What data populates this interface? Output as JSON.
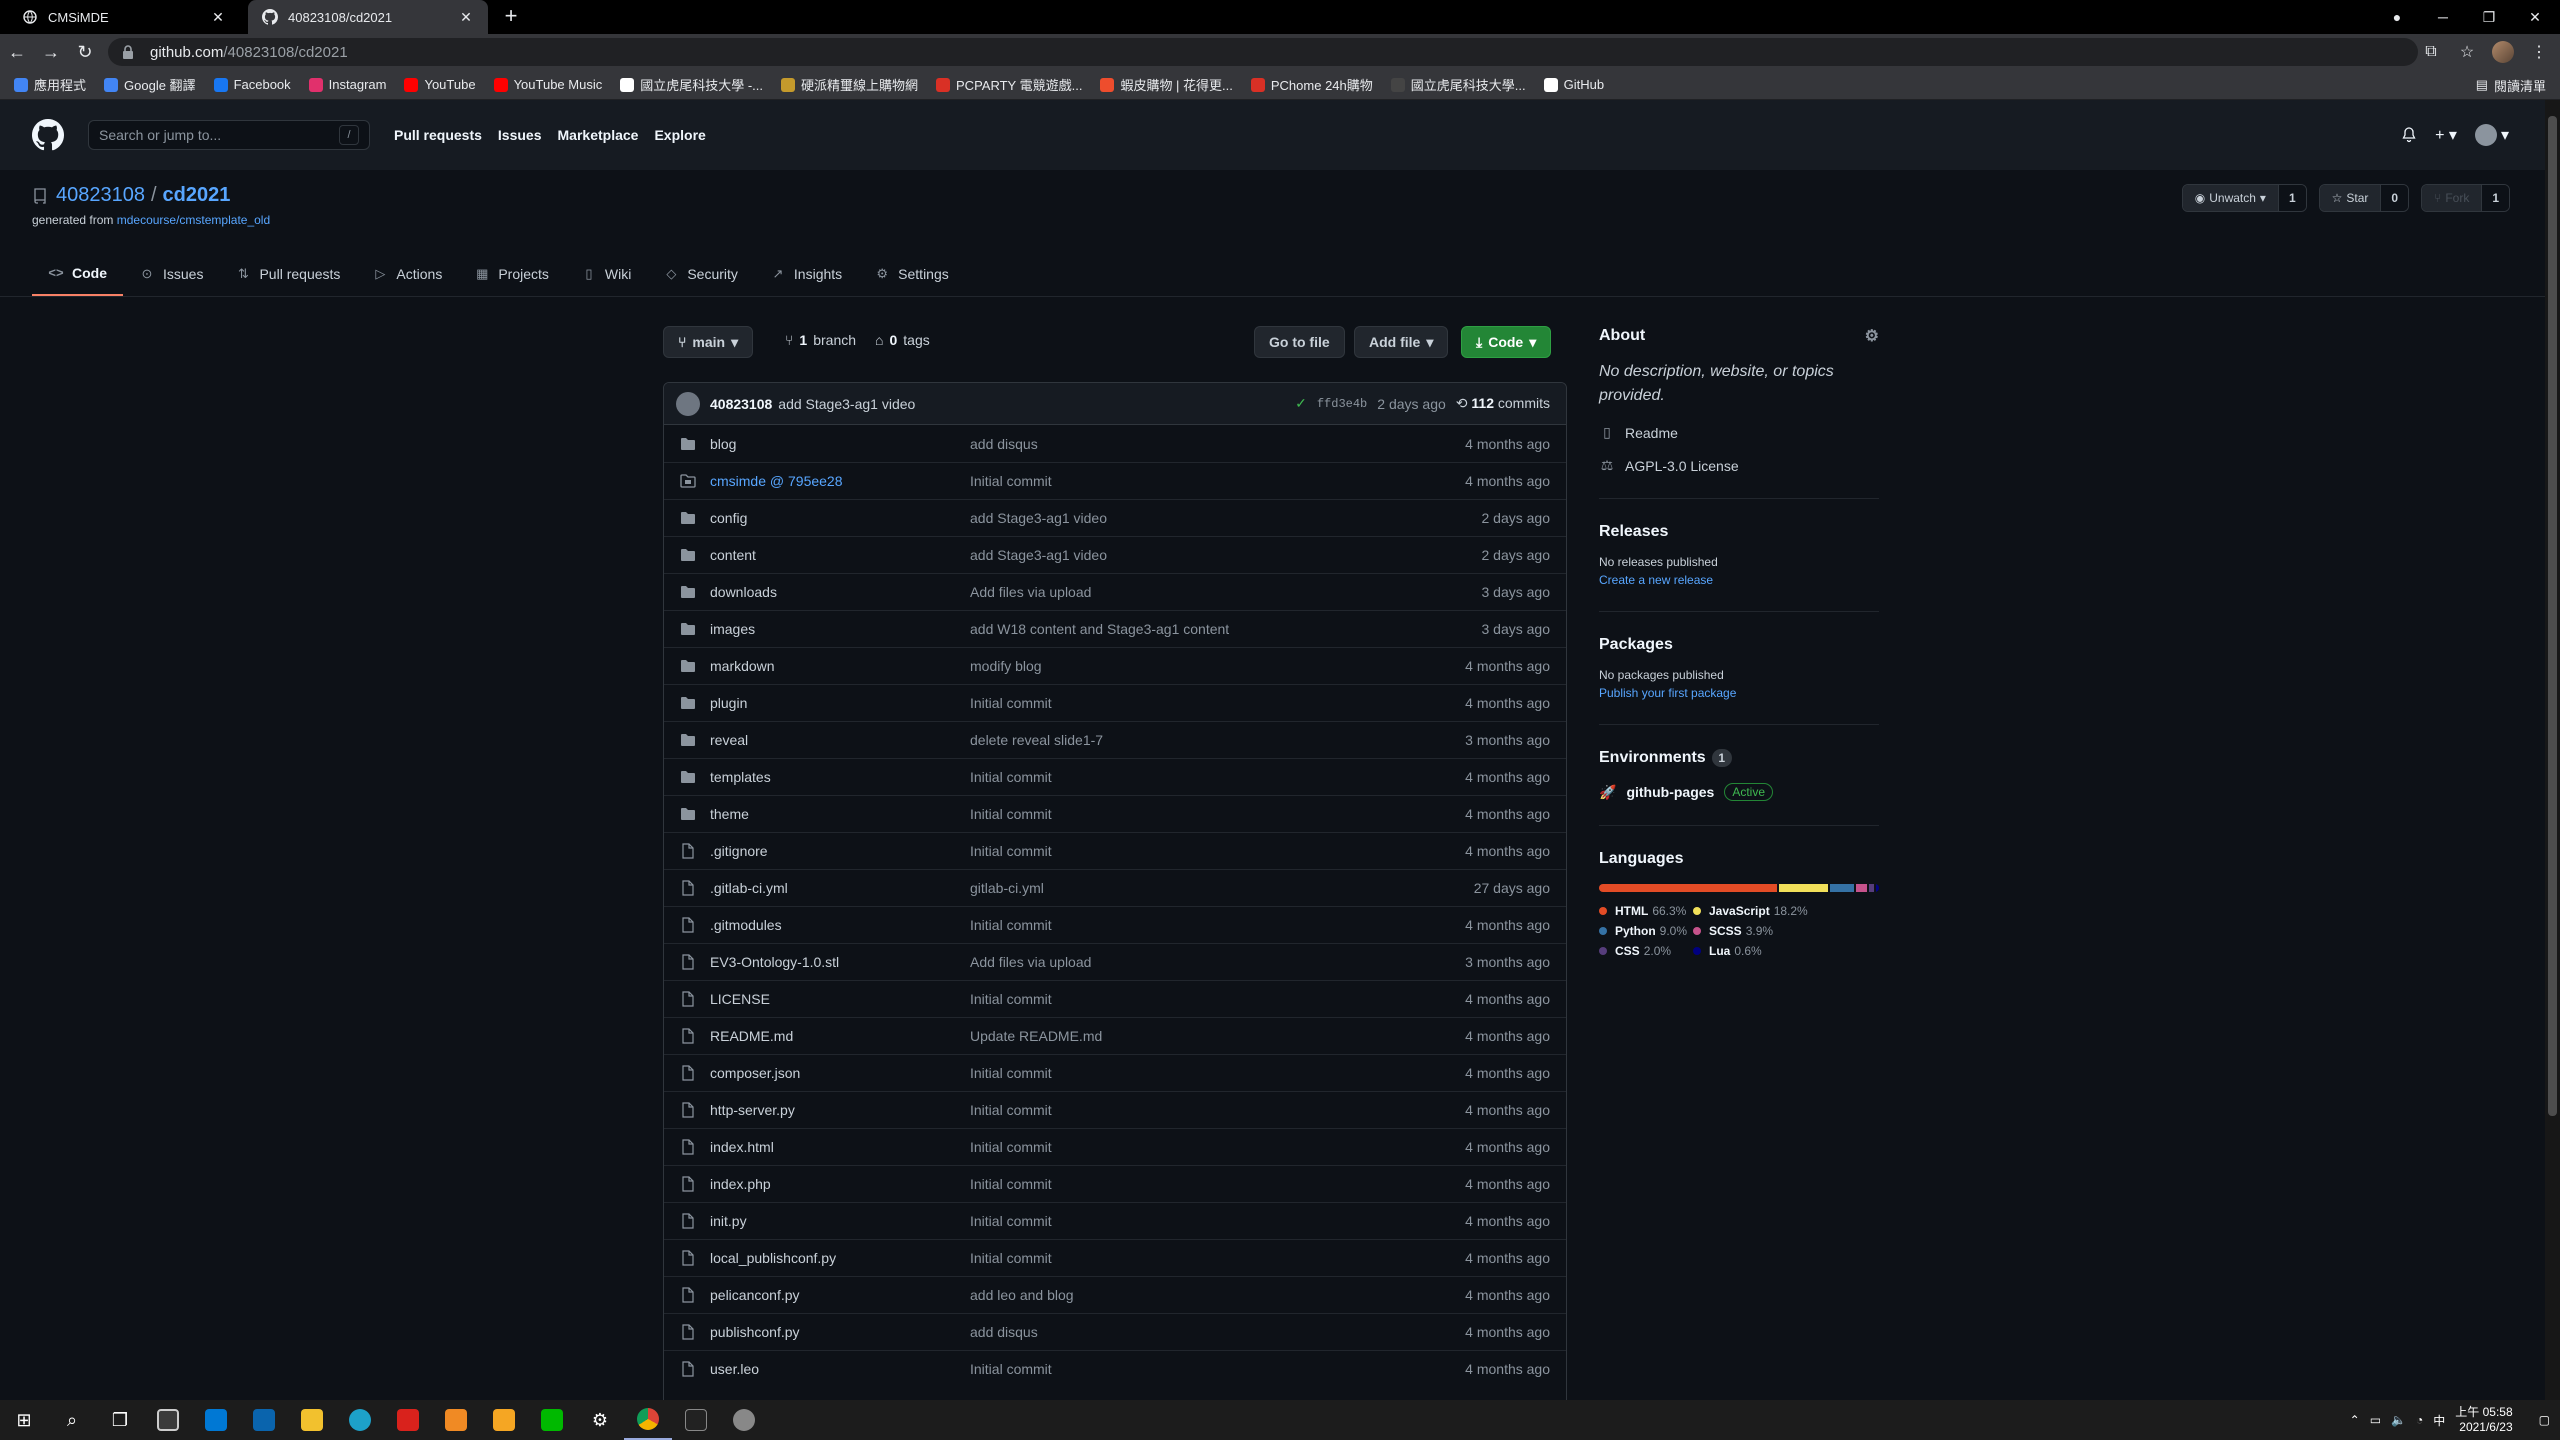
{
  "browser": {
    "tabs": [
      {
        "label": "CMSiMDE",
        "active": false
      },
      {
        "label": "40823108/cd2021",
        "active": true
      }
    ],
    "url_host": "github.com",
    "url_path": "/40823108/cd2021",
    "bookmarks": [
      {
        "label": "應用程式",
        "color": "#4285f4"
      },
      {
        "label": "Google 翻譯",
        "color": "#4285f4"
      },
      {
        "label": "Facebook",
        "color": "#1877f2"
      },
      {
        "label": "Instagram",
        "color": "#e1306c"
      },
      {
        "label": "YouTube",
        "color": "#ff0000"
      },
      {
        "label": "YouTube Music",
        "color": "#ff0000"
      },
      {
        "label": "國立虎尾科技大學 -...",
        "color": "#ffffff"
      },
      {
        "label": "硬派精璽線上購物網",
        "color": "#c49a2c"
      },
      {
        "label": "PCPARTY 電競遊戲...",
        "color": "#d93025"
      },
      {
        "label": "蝦皮購物 | 花得更...",
        "color": "#ee4d2d"
      },
      {
        "label": "PChome 24h購物",
        "color": "#d93025"
      },
      {
        "label": "國立虎尾科技大學...",
        "color": "#444444"
      },
      {
        "label": "GitHub",
        "color": "#ffffff"
      }
    ],
    "reading_list": "閱讀清單"
  },
  "github": {
    "search_placeholder": "Search or jump to...",
    "search_key": "/",
    "nav": [
      "Pull requests",
      "Issues",
      "Marketplace",
      "Explore"
    ]
  },
  "repo": {
    "owner": "40823108",
    "name": "cd2021",
    "generated_prefix": "generated from",
    "generated_link": "mdecourse/cmstemplate_old",
    "watch_label": "Unwatch",
    "watch_count": "1",
    "star_label": "Star",
    "star_count": "0",
    "fork_label": "Fork",
    "fork_count": "1",
    "tabs": [
      {
        "label": "Code",
        "icon": "code-icon",
        "glyph": "<>"
      },
      {
        "label": "Issues",
        "icon": "issue-icon",
        "glyph": "⊙"
      },
      {
        "label": "Pull requests",
        "icon": "pull-request-icon",
        "glyph": "⇅"
      },
      {
        "label": "Actions",
        "icon": "play-icon",
        "glyph": "▷"
      },
      {
        "label": "Projects",
        "icon": "project-icon",
        "glyph": "▦"
      },
      {
        "label": "Wiki",
        "icon": "book-icon",
        "glyph": "▯"
      },
      {
        "label": "Security",
        "icon": "shield-icon",
        "glyph": "◇"
      },
      {
        "label": "Insights",
        "icon": "graph-icon",
        "glyph": "↗"
      },
      {
        "label": "Settings",
        "icon": "gear-icon",
        "glyph": "⚙"
      }
    ]
  },
  "filenav": {
    "branch": "main",
    "branch_count": "1",
    "branch_label": "branch",
    "tag_count": "0",
    "tag_label": "tags",
    "goto_label": "Go to file",
    "addfile_label": "Add file",
    "code_label": "Code"
  },
  "commit": {
    "user": "40823108",
    "message": "add Stage3-ag1 video",
    "sha": "ffd3e4b",
    "age": "2 days ago",
    "count": "112",
    "count_label": "commits"
  },
  "files": [
    {
      "name": "blog",
      "type": "dir",
      "message": "add disqus",
      "age": "4 months ago"
    },
    {
      "name": "cmsimde @ 795ee28",
      "type": "submodule",
      "message": "Initial commit",
      "age": "4 months ago"
    },
    {
      "name": "config",
      "type": "dir",
      "message": "add Stage3-ag1 video",
      "age": "2 days ago"
    },
    {
      "name": "content",
      "type": "dir",
      "message": "add Stage3-ag1 video",
      "age": "2 days ago"
    },
    {
      "name": "downloads",
      "type": "dir",
      "message": "Add files via upload",
      "age": "3 days ago"
    },
    {
      "name": "images",
      "type": "dir",
      "message": "add W18 content and Stage3-ag1 content",
      "age": "3 days ago"
    },
    {
      "name": "markdown",
      "type": "dir",
      "message": "modify blog",
      "age": "4 months ago"
    },
    {
      "name": "plugin",
      "type": "dir",
      "message": "Initial commit",
      "age": "4 months ago"
    },
    {
      "name": "reveal",
      "type": "dir",
      "message": "delete reveal slide1-7",
      "age": "3 months ago"
    },
    {
      "name": "templates",
      "type": "dir",
      "message": "Initial commit",
      "age": "4 months ago"
    },
    {
      "name": "theme",
      "type": "dir",
      "message": "Initial commit",
      "age": "4 months ago"
    },
    {
      "name": ".gitignore",
      "type": "file",
      "message": "Initial commit",
      "age": "4 months ago"
    },
    {
      "name": ".gitlab-ci.yml",
      "type": "file",
      "message": "gitlab-ci.yml",
      "age": "27 days ago"
    },
    {
      "name": ".gitmodules",
      "type": "file",
      "message": "Initial commit",
      "age": "4 months ago"
    },
    {
      "name": "EV3-Ontology-1.0.stl",
      "type": "file",
      "message": "Add files via upload",
      "age": "3 months ago"
    },
    {
      "name": "LICENSE",
      "type": "file",
      "message": "Initial commit",
      "age": "4 months ago"
    },
    {
      "name": "README.md",
      "type": "file",
      "message": "Update README.md",
      "age": "4 months ago"
    },
    {
      "name": "composer.json",
      "type": "file",
      "message": "Initial commit",
      "age": "4 months ago"
    },
    {
      "name": "http-server.py",
      "type": "file",
      "message": "Initial commit",
      "age": "4 months ago"
    },
    {
      "name": "index.html",
      "type": "file",
      "message": "Initial commit",
      "age": "4 months ago"
    },
    {
      "name": "index.php",
      "type": "file",
      "message": "Initial commit",
      "age": "4 months ago"
    },
    {
      "name": "init.py",
      "type": "file",
      "message": "Initial commit",
      "age": "4 months ago"
    },
    {
      "name": "local_publishconf.py",
      "type": "file",
      "message": "Initial commit",
      "age": "4 months ago"
    },
    {
      "name": "pelicanconf.py",
      "type": "file",
      "message": "add leo and blog",
      "age": "4 months ago"
    },
    {
      "name": "publishconf.py",
      "type": "file",
      "message": "add disqus",
      "age": "4 months ago"
    },
    {
      "name": "user.leo",
      "type": "file",
      "message": "Initial commit",
      "age": "4 months ago"
    }
  ],
  "about": {
    "title": "About",
    "description": "No description, website, or topics provided.",
    "readme": "Readme",
    "license": "AGPL-3.0 License"
  },
  "releases": {
    "title": "Releases",
    "empty": "No releases published",
    "link": "Create a new release"
  },
  "packages": {
    "title": "Packages",
    "empty": "No packages published",
    "link": "Publish your first package"
  },
  "environments": {
    "title": "Environments",
    "count": "1",
    "name": "github-pages",
    "status": "Active"
  },
  "languages": {
    "title": "Languages",
    "items": [
      {
        "name": "HTML",
        "pct": "66.3%",
        "value": 66.3,
        "color": "#e34c26"
      },
      {
        "name": "JavaScript",
        "pct": "18.2%",
        "value": 18.2,
        "color": "#f1e05a"
      },
      {
        "name": "Python",
        "pct": "9.0%",
        "value": 9.0,
        "color": "#3572a5"
      },
      {
        "name": "SCSS",
        "pct": "3.9%",
        "value": 3.9,
        "color": "#c6538c"
      },
      {
        "name": "CSS",
        "pct": "2.0%",
        "value": 2.0,
        "color": "#563d7c"
      },
      {
        "name": "Lua",
        "pct": "0.6%",
        "value": 0.6,
        "color": "#000080"
      }
    ]
  },
  "clock": {
    "time": "上午 05:58",
    "date": "2021/6/23"
  }
}
